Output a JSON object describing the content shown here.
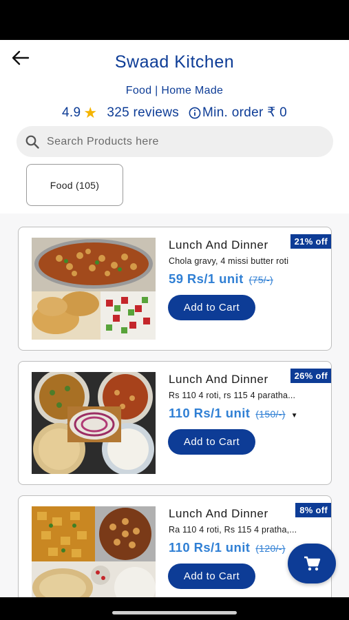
{
  "store": {
    "title": "Swaad Kitchen",
    "category": "Food | Home Made",
    "rating": "4.9",
    "reviews": "325 reviews",
    "min_order": "Min. order ₹ 0"
  },
  "search": {
    "placeholder": "Search Products here"
  },
  "category_chip": {
    "label": "Food (105)"
  },
  "products": [
    {
      "name": "Lunch And Dinner",
      "badge": "21% off",
      "description": "Chola gravy, 4 missi butter roti",
      "price": "59 Rs/1 unit",
      "mrp": "(75/-)",
      "has_variants": false,
      "add_label": "Add to Cart"
    },
    {
      "name": "Lunch And Dinner",
      "badge": "26% off",
      "description": "Rs 110 4 roti, rs 115 4 paratha...",
      "price": "110 Rs/1 unit",
      "mrp": "(150/-)",
      "has_variants": true,
      "add_label": "Add to Cart"
    },
    {
      "name": "Lunch And Dinner",
      "badge": "8% off",
      "description": "Ra 110 4 roti, Rs 115 4 pratha,...",
      "price": "110 Rs/1 unit",
      "mrp": "(120/-)",
      "has_variants": false,
      "add_label": "Add to Cart"
    }
  ],
  "icons": {
    "back": "arrow-left-icon",
    "rating": "star-icon",
    "info": "info-icon",
    "search": "search-icon",
    "cart": "cart-icon",
    "variants": "caret-down-icon"
  },
  "colors": {
    "brand": "#0d3c96",
    "price": "#2f7fd4",
    "star": "#f5b400"
  }
}
